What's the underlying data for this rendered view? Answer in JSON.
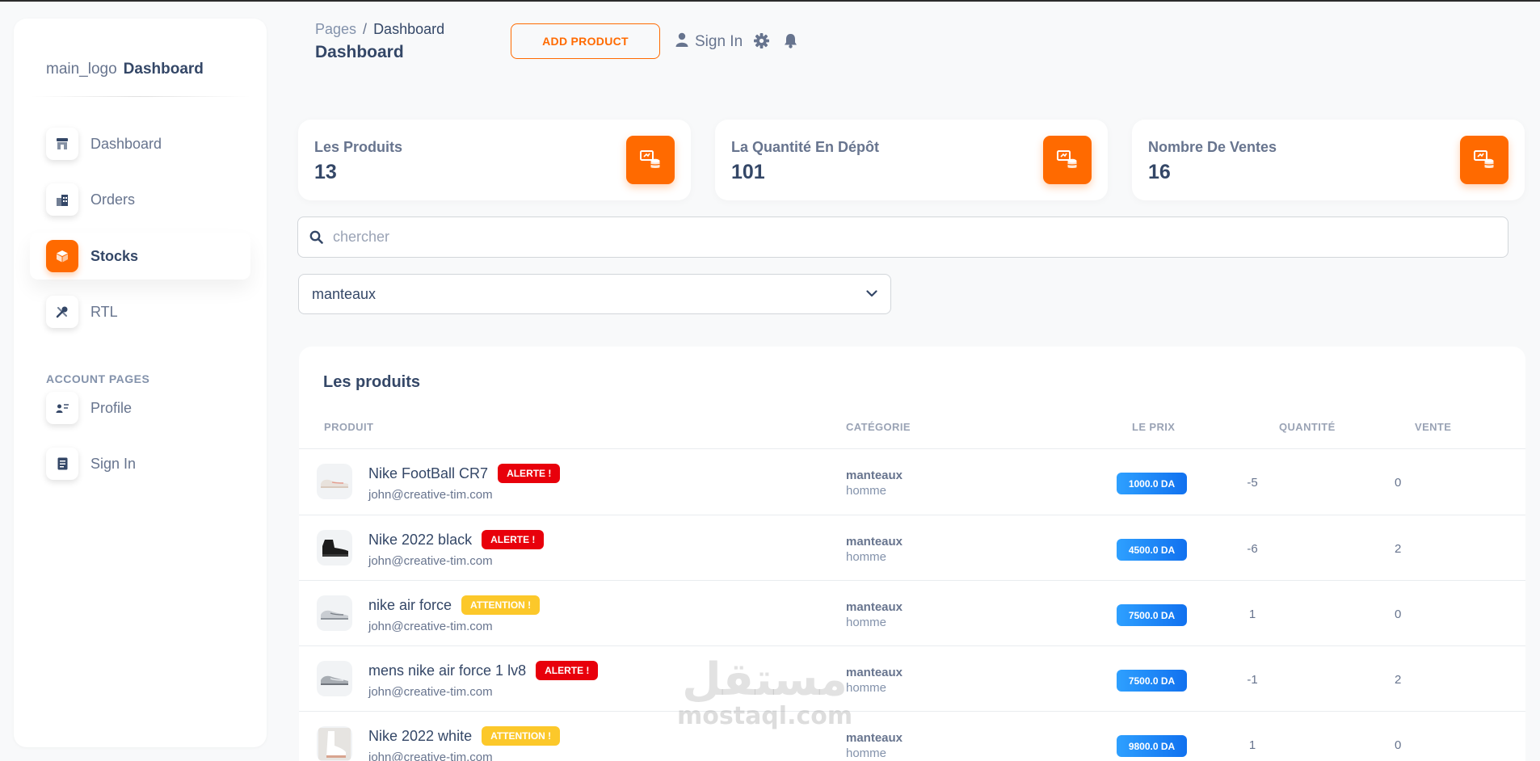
{
  "sidebar": {
    "brand": {
      "logo_alt": "main_logo",
      "name": "Dashboard"
    },
    "items": [
      {
        "label": "Dashboard",
        "icon": "shop-icon"
      },
      {
        "label": "Orders",
        "icon": "office-icon"
      },
      {
        "label": "Stocks",
        "icon": "box-icon",
        "active": true
      },
      {
        "label": "RTL",
        "icon": "tools-icon"
      }
    ],
    "section_title": "ACCOUNT PAGES",
    "account_items": [
      {
        "label": "Profile",
        "icon": "profile-icon"
      },
      {
        "label": "Sign In",
        "icon": "document-icon"
      }
    ]
  },
  "header": {
    "breadcrumb": {
      "root": "Pages",
      "separator": "/",
      "current": "Dashboard"
    },
    "title": "Dashboard",
    "add_button": "ADD PRODUCT",
    "signin": "Sign In"
  },
  "stats": [
    {
      "label": "Les Produits",
      "value": "13"
    },
    {
      "label": "La Quantité En Dépôt",
      "value": "101"
    },
    {
      "label": "Nombre De Ventes",
      "value": "16"
    }
  ],
  "search": {
    "placeholder": "chercher"
  },
  "category_select": {
    "value": "manteaux"
  },
  "table": {
    "title": "Les produits",
    "columns": [
      "PRODUIT",
      "CATÉGORIE",
      "LE PRIX",
      "QUANTITÉ",
      "VENTE"
    ],
    "rows": [
      {
        "name": "Nike FootBall CR7",
        "badge": "ALERTE !",
        "email": "john@creative-tim.com",
        "category": "manteaux",
        "subcategory": "homme",
        "price": "1000.0 DA",
        "quantity": "-5",
        "vente": "0"
      },
      {
        "name": "Nike 2022 black",
        "badge": "ALERTE !",
        "email": "john@creative-tim.com",
        "category": "manteaux",
        "subcategory": "homme",
        "price": "4500.0 DA",
        "quantity": "-6",
        "vente": "2"
      },
      {
        "name": "nike air force",
        "badge": "ATTENTION !",
        "email": "john@creative-tim.com",
        "category": "manteaux",
        "subcategory": "homme",
        "price": "7500.0 DA",
        "quantity": "1",
        "vente": "0"
      },
      {
        "name": "mens nike air force 1 lv8",
        "badge": "ALERTE !",
        "email": "john@creative-tim.com",
        "category": "manteaux",
        "subcategory": "homme",
        "price": "7500.0 DA",
        "quantity": "-1",
        "vente": "2"
      },
      {
        "name": "Nike 2022 white",
        "badge": "ATTENTION !",
        "email": "john@creative-tim.com",
        "category": "manteaux",
        "subcategory": "homme",
        "price": "9800.0 DA",
        "quantity": "1",
        "vente": "0"
      }
    ]
  },
  "watermark": {
    "arabic": "مستقل",
    "latin": "mostaql.com"
  },
  "colors": {
    "accent": "#ff6a00",
    "alert": "#e8000b",
    "warning": "#fcc82a",
    "price": "#1a8cff",
    "text": "#344767",
    "muted": "#67748e"
  }
}
